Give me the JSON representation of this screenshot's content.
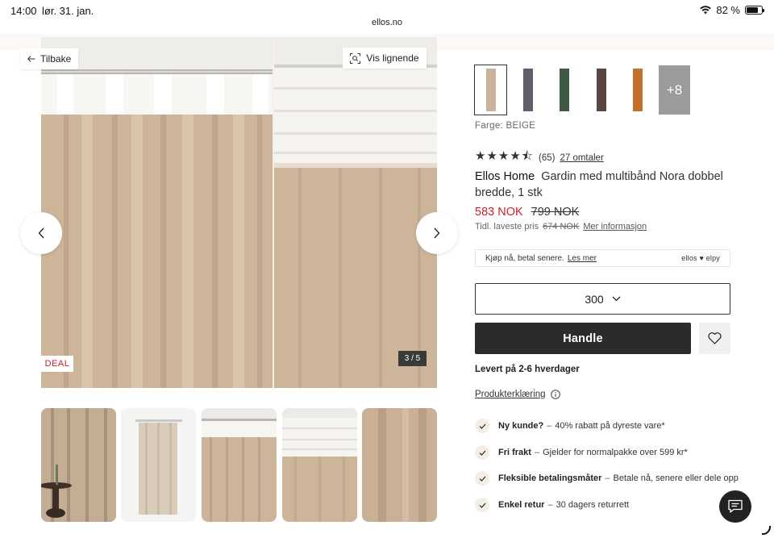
{
  "status_bar": {
    "time": "14:00",
    "date": "lør. 31. jan.",
    "battery": "82 %"
  },
  "browser": {
    "url": "ellos.no"
  },
  "gallery": {
    "back_label": "Tilbake",
    "similar_label": "Vis lignende",
    "deal_badge": "DEAL",
    "counter": "3 / 5"
  },
  "product": {
    "color_label": "Farge: BEIGE",
    "swatch_colors": [
      "#c9b29a",
      "#5d6068",
      "#3f5a43",
      "#5a4640",
      "#c2702c"
    ],
    "more_swatches": "+8",
    "rating_value": 4.5,
    "rating_count": "(65)",
    "reviews_link": "27 omtaler",
    "brand": "Ellos Home",
    "name": "Gardin med multibånd Nora dobbel bredde, 1 stk",
    "price_now": "583 NOK",
    "price_old": "799 NOK",
    "price_hint_prefix": "Tidl. laveste pris",
    "price_hint_value": "674 NOK",
    "price_hint_link": "Mer informasjon",
    "pay_text": "Kjøp nå, betal senere.",
    "pay_link": "Les mer",
    "pay_logo": "ellos ♥ elpy",
    "size_value": "300",
    "buy_label": "Handle",
    "delivery": "Levert på 2-6 hverdager",
    "declaration": "Produkterklæring"
  },
  "usps": [
    {
      "title": "Ny kunde?",
      "text": "40% rabatt på dyreste vare*"
    },
    {
      "title": "Fri frakt",
      "text": "Gjelder for normalpakke over 599 kr*"
    },
    {
      "title": "Fleksible betalingsmåter",
      "text": "Betale nå, senere eller dele opp"
    },
    {
      "title": "Enkel retur",
      "text": "30 dagers returrett"
    }
  ],
  "colors": {
    "accent_red": "#c8202e",
    "button_dark": "#2b2b2b",
    "curtain_beige": "#cdb59a"
  }
}
